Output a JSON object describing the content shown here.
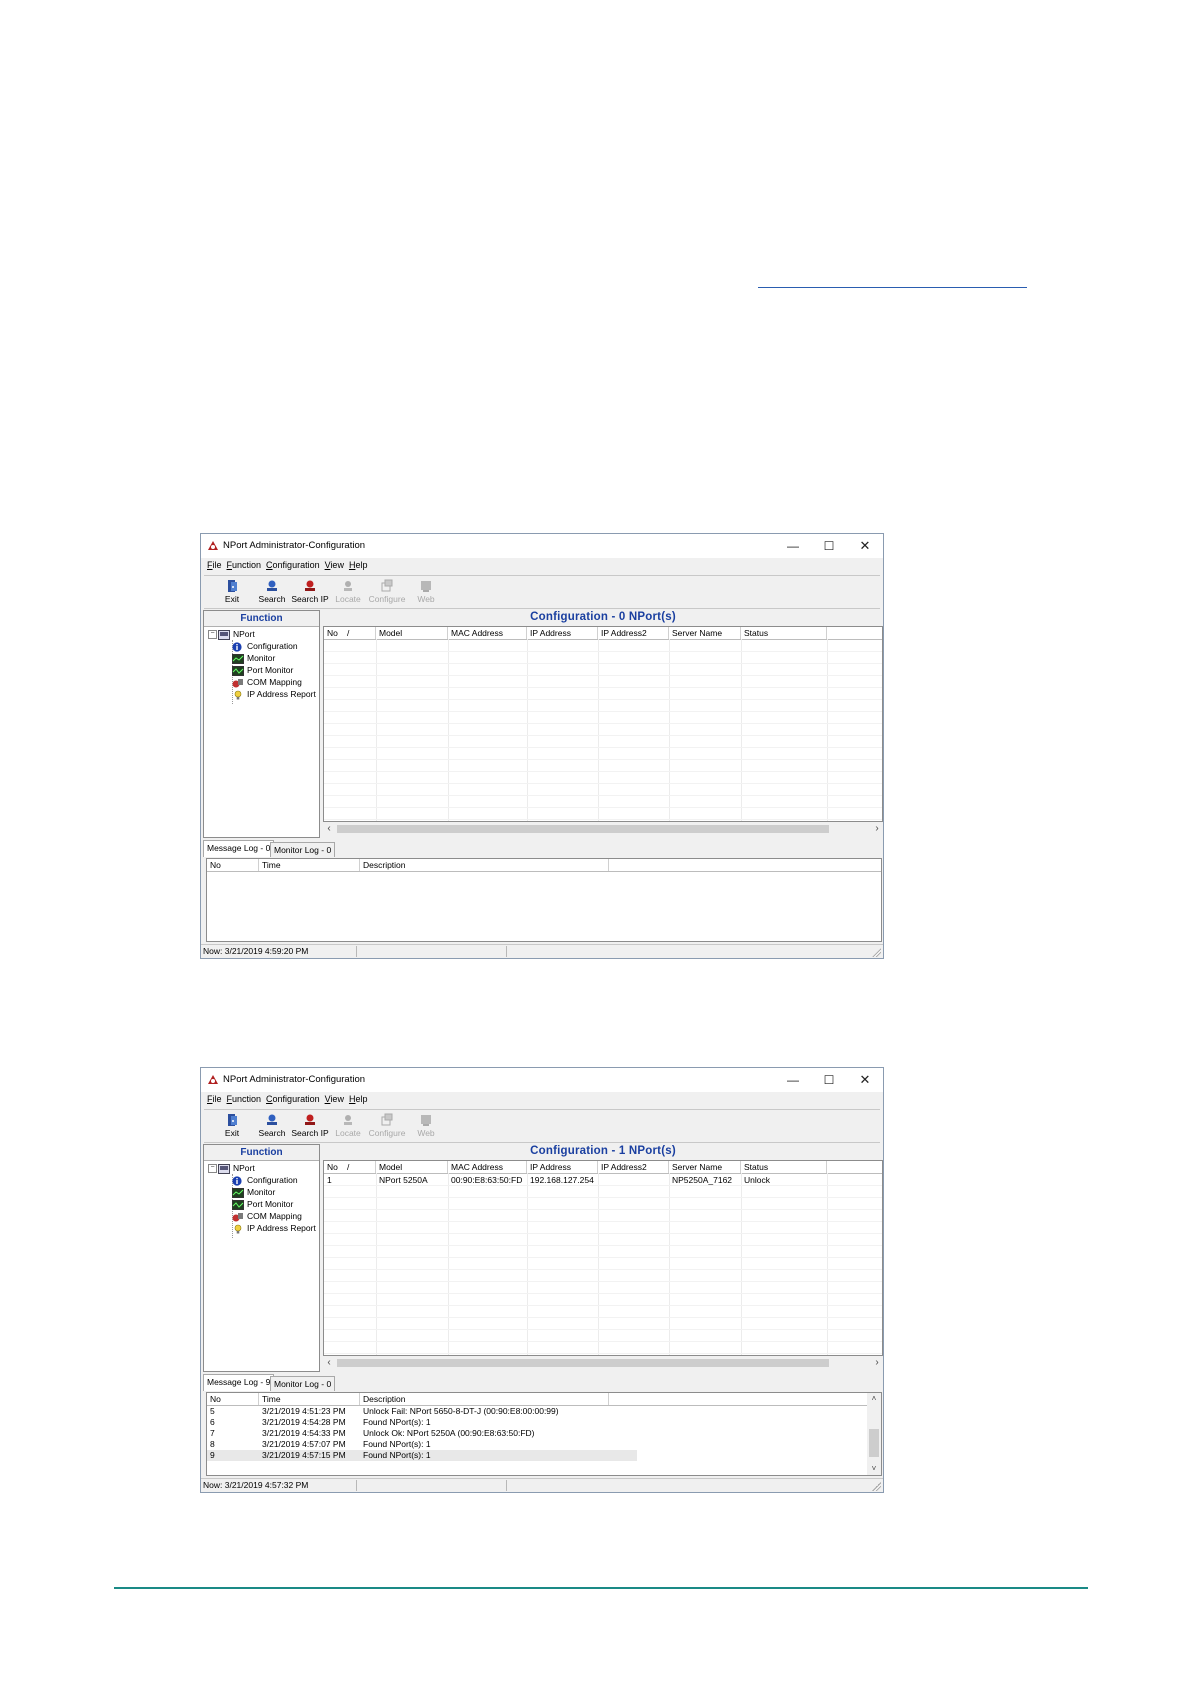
{
  "windows": [
    {
      "title": "NPort Administrator-Configuration",
      "menu": [
        "File",
        "Function",
        "Configuration",
        "View",
        "Help"
      ],
      "toolbar": [
        {
          "label": "Exit",
          "icon": "exit-icon",
          "enabled": true
        },
        {
          "label": "Search",
          "icon": "search-icon",
          "enabled": true
        },
        {
          "label": "Search IP",
          "icon": "search-ip-icon",
          "enabled": true
        },
        {
          "label": "Locate",
          "icon": "locate-icon",
          "enabled": false
        },
        {
          "label": "Configure",
          "icon": "configure-icon",
          "enabled": false
        },
        {
          "label": "Web",
          "icon": "web-icon",
          "enabled": false
        }
      ],
      "function_header": "Function",
      "tree_root": "NPort",
      "tree_items": [
        "Configuration",
        "Monitor",
        "Port Monitor",
        "COM Mapping",
        "IP Address Report"
      ],
      "content_header": "Configuration - 0 NPort(s)",
      "columns": [
        "No",
        "/",
        "Model",
        "MAC Address",
        "IP Address",
        "IP Address2",
        "Server Name",
        "Status"
      ],
      "rows": [],
      "tabs": [
        "Message Log - 0",
        "Monitor Log - 0"
      ],
      "log_columns": [
        "No",
        "Time",
        "Description"
      ],
      "log_rows": [],
      "status": "Now: 3/21/2019 4:59:20 PM"
    },
    {
      "title": "NPort Administrator-Configuration",
      "menu": [
        "File",
        "Function",
        "Configuration",
        "View",
        "Help"
      ],
      "toolbar": [
        {
          "label": "Exit",
          "icon": "exit-icon",
          "enabled": true
        },
        {
          "label": "Search",
          "icon": "search-icon",
          "enabled": true
        },
        {
          "label": "Search IP",
          "icon": "search-ip-icon",
          "enabled": true
        },
        {
          "label": "Locate",
          "icon": "locate-icon",
          "enabled": false
        },
        {
          "label": "Configure",
          "icon": "configure-icon",
          "enabled": false
        },
        {
          "label": "Web",
          "icon": "web-icon",
          "enabled": false
        }
      ],
      "function_header": "Function",
      "tree_root": "NPort",
      "tree_items": [
        "Configuration",
        "Monitor",
        "Port Monitor",
        "COM Mapping",
        "IP Address Report"
      ],
      "content_header": "Configuration - 1 NPort(s)",
      "columns": [
        "No",
        "/",
        "Model",
        "MAC Address",
        "IP Address",
        "IP Address2",
        "Server Name",
        "Status"
      ],
      "rows": [
        {
          "no": "1",
          "model": "NPort 5250A",
          "mac": "00:90:E8:63:50:FD",
          "ip": "192.168.127.254",
          "ip2": "",
          "server": "NP5250A_7162",
          "status": "Unlock"
        }
      ],
      "tabs": [
        "Message Log - 9",
        "Monitor Log - 0"
      ],
      "log_columns": [
        "No",
        "Time",
        "Description"
      ],
      "log_rows": [
        {
          "no": "5",
          "time": "3/21/2019 4:51:23 PM",
          "desc": "Unlock Fail: NPort 5650-8-DT-J (00:90:E8:00:00:99)"
        },
        {
          "no": "6",
          "time": "3/21/2019 4:54:28 PM",
          "desc": "Found NPort(s): 1"
        },
        {
          "no": "7",
          "time": "3/21/2019 4:54:33 PM",
          "desc": "Unlock Ok: NPort 5250A (00:90:E8:63:50:FD)"
        },
        {
          "no": "8",
          "time": "3/21/2019 4:57:07 PM",
          "desc": "Found NPort(s): 1"
        },
        {
          "no": "9",
          "time": "3/21/2019 4:57:15 PM",
          "desc": "Found NPort(s): 1"
        }
      ],
      "selected_log_row": 4,
      "status": "Now: 3/21/2019 4:57:32 PM"
    }
  ],
  "colors": {
    "accent": "#1a3fa0",
    "footer_rule": "#1a8a86",
    "link": "#2a5db0"
  }
}
